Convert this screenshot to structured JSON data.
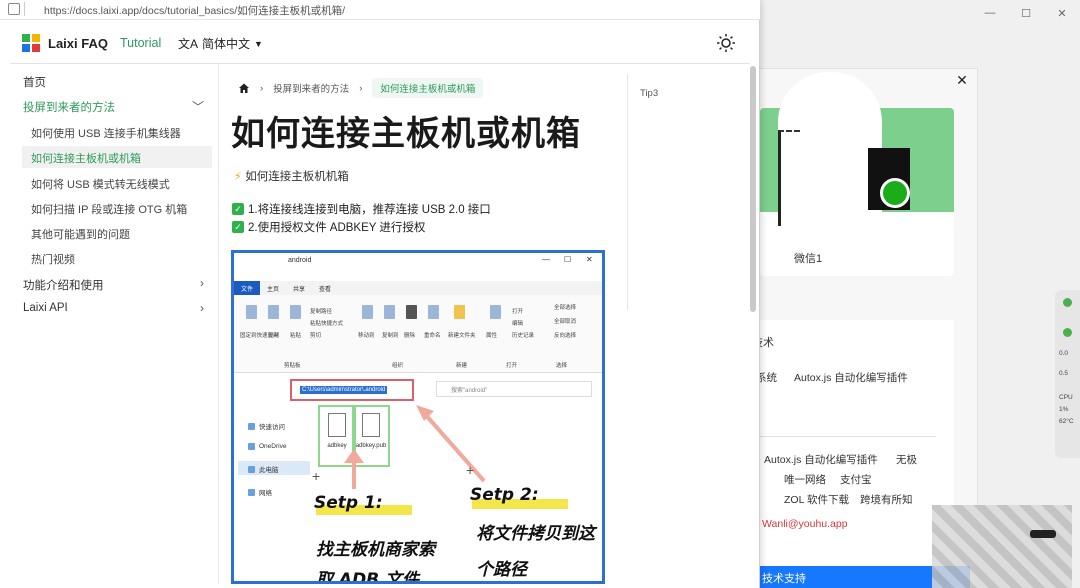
{
  "browser": {
    "url": "https://docs.laixi.app/docs/tutorial_basics/如何连接主板机或机箱/"
  },
  "header": {
    "logo_text": "Laixi FAQ",
    "nav_tutorial": "Tutorial",
    "lang_label": "简体中文",
    "lang_icon": "translate-icon",
    "theme_icon": "sun-icon"
  },
  "sidebar": {
    "items": [
      {
        "label": "首页"
      },
      {
        "label": "投屏到来者的方法"
      },
      {
        "label": "如何使用 USB 连接手机集线器"
      },
      {
        "label": "如何连接主板机或机箱"
      },
      {
        "label": "如何将 USB 模式转无线模式"
      },
      {
        "label": "如何扫描 IP 段或连接 OTG 机箱"
      },
      {
        "label": "其他可能遇到的问题"
      },
      {
        "label": "热门视频"
      },
      {
        "label": "功能介绍和使用"
      },
      {
        "label": "Laixi API"
      }
    ]
  },
  "breadcrumb": {
    "parent": "投屏到来者的方法",
    "current": "如何连接主板机或机箱"
  },
  "article": {
    "title": "如何连接主板机或机箱",
    "lead": "如何连接主板机机箱",
    "steps": [
      "1.将连接线连接到电脑，推荐连接 USB 2.0 接口",
      "2.使用授权文件 ADBKEY 进行授权"
    ]
  },
  "toc": {
    "label": "Tip3"
  },
  "screenshot": {
    "window_title": "android",
    "tabs": [
      "文件",
      "主页",
      "共享",
      "查看"
    ],
    "ribbon_labels": [
      "固定到快速访问",
      "复制",
      "粘贴",
      "复制路径",
      "粘贴快捷方式",
      "剪切",
      "移动到",
      "复制到",
      "删除",
      "重命名",
      "新建文件夹",
      "属性",
      "打开",
      "编辑",
      "历史记录",
      "全部选择",
      "全部取消",
      "反向选择"
    ],
    "group_labels": [
      "剪贴板",
      "组织",
      "新建",
      "打开",
      "选择"
    ],
    "address": "C:\\Users\\admin\\strator\\.android",
    "search_placeholder": "搜索\"android\"",
    "tree": [
      "快速访问",
      "OneDrive",
      "此电脑",
      "网络"
    ],
    "files": [
      "adbkey",
      "adbkey.pub"
    ],
    "step1_title": "Setp 1:",
    "step1_text": "找主板机商家索",
    "step1_text2": "取 ADB 文件",
    "step2_title": "Setp 2:",
    "step2_text": "将文件拷贝到这",
    "step2_text2": "个路径"
  },
  "background_panel": {
    "qr_caption": "微信1",
    "section_title": "技术",
    "links_row1": [
      "系统",
      "Autox.js 自动化编写插件"
    ],
    "links_row2": [
      "Autox.js 自动化编写插件",
      "无极"
    ],
    "links_row3": [
      "唯一网络",
      "支付宝"
    ],
    "links_row4": [
      "ZOL 软件下载",
      "跨境有所知"
    ],
    "email": "Wanli@youhu.app",
    "bottom_bar": "技术支持",
    "side_widget": [
      "0.0",
      "0.5",
      "CPU",
      "1%",
      "62°C"
    ]
  }
}
